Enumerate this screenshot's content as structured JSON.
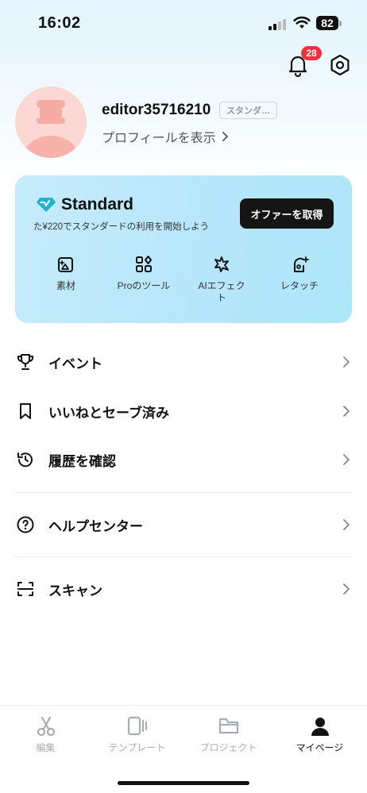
{
  "status_bar": {
    "time": "16:02",
    "battery": "82"
  },
  "header": {
    "notification_count": "28"
  },
  "profile": {
    "username": "editor35716210",
    "plan_tag": "スタンダ…",
    "view_profile": "プロフィールを表示"
  },
  "standard_card": {
    "title": "Standard",
    "subtitle": "た¥220でスタンダードの利用を開始しよう",
    "offer_button": "オファーを取得",
    "features": [
      {
        "label": "素材",
        "icon": "image-sparkle-icon"
      },
      {
        "label": "Proのツール",
        "icon": "tools-grid-icon"
      },
      {
        "label": "AIエフェクト",
        "icon": "ai-effect-icon"
      },
      {
        "label": "レタッチ",
        "icon": "retouch-face-icon"
      }
    ],
    "accent_color": "#1fb3d1"
  },
  "menu": {
    "items": [
      {
        "label": "イベント",
        "icon": "trophy-icon"
      },
      {
        "label": "いいねとセーブ済み",
        "icon": "bookmark-icon"
      },
      {
        "label": "履歴を確認",
        "icon": "history-icon"
      },
      {
        "label": "ヘルプセンター",
        "icon": "help-icon"
      },
      {
        "label": "スキャン",
        "icon": "scan-icon"
      }
    ]
  },
  "bottom_nav": {
    "items": [
      {
        "label": "編集",
        "icon": "scissors-icon",
        "active": false
      },
      {
        "label": "テンプレート",
        "icon": "template-icon",
        "active": false
      },
      {
        "label": "プロジェクト",
        "icon": "folder-icon",
        "active": false
      },
      {
        "label": "マイページ",
        "icon": "person-icon",
        "active": true
      }
    ]
  },
  "colors": {
    "badge": "#f0323c",
    "button_dark": "#151515",
    "card_bg": "#b7e6fb",
    "inactive_nav": "#a8adb2"
  }
}
